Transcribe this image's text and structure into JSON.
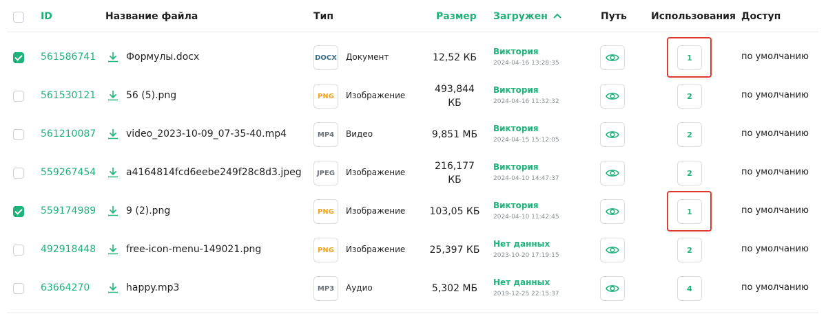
{
  "header": {
    "id": "ID",
    "name": "Название файла",
    "type": "Тип",
    "size": "Размер",
    "uploaded": "Загружен",
    "path": "Путь",
    "usages": "Использования",
    "access": "Доступ"
  },
  "colors": {
    "accent": "#1fb27a",
    "highlight": "#e03a2f"
  },
  "rows": [
    {
      "checked": true,
      "id": "561586741",
      "name": "Формулы.docx",
      "badge": "DOCX",
      "badge_color": "#3a6e86",
      "type": "Документ",
      "size": "12,52 КБ",
      "uploader": "Виктория",
      "date": "2024-04-16 13:28:35",
      "uses": "1",
      "access": "по умолчанию",
      "highlight": true
    },
    {
      "checked": false,
      "id": "561530121",
      "name": "56 (5).png",
      "badge": "PNG",
      "badge_color": "#f2a51a",
      "type": "Изображение",
      "size": "493,844 КБ",
      "uploader": "Виктория",
      "date": "2024-04-16 11:32:32",
      "uses": "2",
      "access": "по умолчанию",
      "highlight": false
    },
    {
      "checked": false,
      "id": "561210087",
      "name": "video_2023-10-09_07-35-40.mp4",
      "badge": "MP4",
      "badge_color": "#6b7178",
      "type": "Видео",
      "size": "9,851 МБ",
      "uploader": "Виктория",
      "date": "2024-04-15 15:12:05",
      "uses": "2",
      "access": "по умолчанию",
      "highlight": false
    },
    {
      "checked": false,
      "id": "559267454",
      "name": "a4164814fcd6eebe249f28c8d3.jpeg",
      "badge": "JPEG",
      "badge_color": "#6b7178",
      "type": "Изображение",
      "size": "216,177 КБ",
      "uploader": "Виктория",
      "date": "2024-04-10 14:47:37",
      "uses": "2",
      "access": "по умолчанию",
      "highlight": false
    },
    {
      "checked": true,
      "id": "559174989",
      "name": "9 (2).png",
      "badge": "PNG",
      "badge_color": "#f2a51a",
      "type": "Изображение",
      "size": "103,05 КБ",
      "uploader": "Виктория",
      "date": "2024-04-10 11:42:45",
      "uses": "1",
      "access": "по умолчанию",
      "highlight": true
    },
    {
      "checked": false,
      "id": "492918448",
      "name": "free-icon-menu-149021.png",
      "badge": "PNG",
      "badge_color": "#f2a51a",
      "type": "Изображение",
      "size": "25,397 КБ",
      "uploader": "Нет данных",
      "date": "2023-10-20 17:19:15",
      "uses": "2",
      "access": "по умолчанию",
      "highlight": false
    },
    {
      "checked": false,
      "id": "63664270",
      "name": "happy.mp3",
      "badge": "MP3",
      "badge_color": "#6b7178",
      "type": "Аудио",
      "size": "5,302 МБ",
      "uploader": "Нет данных",
      "date": "2019-12-25 22:15:37",
      "uses": "4",
      "access": "по умолчанию",
      "highlight": false
    }
  ]
}
